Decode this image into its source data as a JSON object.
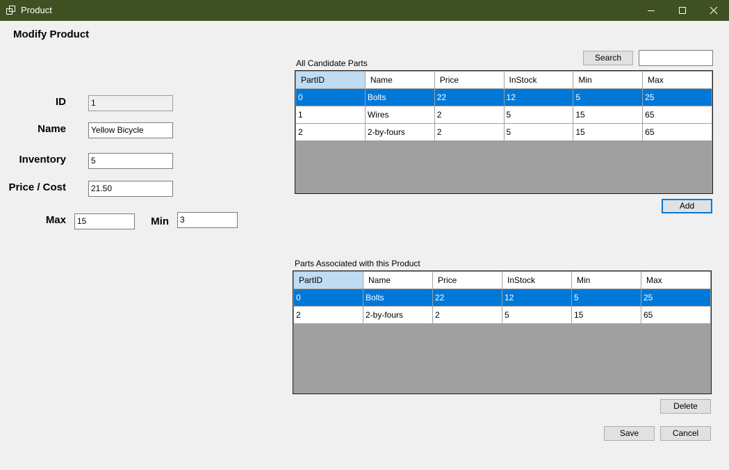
{
  "window": {
    "title": "Product",
    "icons": [
      "window-icon",
      "minimize-icon",
      "maximize-icon",
      "close-icon"
    ]
  },
  "form": {
    "heading": "Modify Product",
    "id_label": "ID",
    "id_value": "1",
    "name_label": "Name",
    "name_value": "Yellow Bicycle",
    "inventory_label": "Inventory",
    "inventory_value": "5",
    "price_label": "Price / Cost",
    "price_value": "21.50",
    "max_label": "Max",
    "max_value": "15",
    "min_label": "Min",
    "min_value": "3"
  },
  "candidates": {
    "label": "All Candidate Parts",
    "search_label": "Search",
    "search_value": "",
    "add_label": "Add",
    "columns": [
      "PartID",
      "Name",
      "Price",
      "InStock",
      "Min",
      "Max"
    ],
    "rows": [
      [
        "0",
        "Bolts",
        "22",
        "12",
        "5",
        "25"
      ],
      [
        "1",
        "Wires",
        "2",
        "5",
        "15",
        "65"
      ],
      [
        "2",
        "2-by-fours",
        "2",
        "5",
        "15",
        "65"
      ]
    ],
    "selected_row": 0
  },
  "associated": {
    "label": "Parts Associated with this Product",
    "delete_label": "Delete",
    "columns": [
      "PartID",
      "Name",
      "Price",
      "InStock",
      "Min",
      "Max"
    ],
    "rows": [
      [
        "0",
        "Bolts",
        "22",
        "12",
        "5",
        "25"
      ],
      [
        "2",
        "2-by-fours",
        "2",
        "5",
        "15",
        "65"
      ]
    ],
    "selected_row": 0
  },
  "actions": {
    "save_label": "Save",
    "cancel_label": "Cancel"
  },
  "colors": {
    "titlebar": "#3f5123",
    "selection": "#0078d7",
    "header_selected": "#bfdcf3",
    "grid_background": "#a0a0a0"
  }
}
